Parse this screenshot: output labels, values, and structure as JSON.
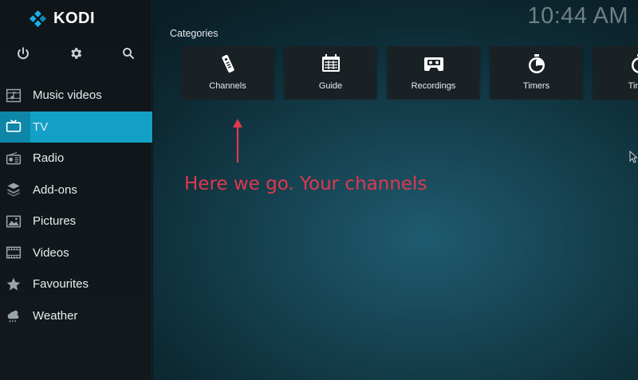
{
  "app": {
    "name": "KODI"
  },
  "clock": "10:44 AM",
  "top_icons": [
    "power-icon",
    "gear-icon",
    "search-icon"
  ],
  "menu": [
    {
      "label": "Music videos",
      "icon": "music-video-icon",
      "active": false
    },
    {
      "label": "TV",
      "icon": "tv-icon",
      "active": true
    },
    {
      "label": "Radio",
      "icon": "radio-icon",
      "active": false
    },
    {
      "label": "Add-ons",
      "icon": "addons-icon",
      "active": false
    },
    {
      "label": "Pictures",
      "icon": "pictures-icon",
      "active": false
    },
    {
      "label": "Videos",
      "icon": "videos-icon",
      "active": false
    },
    {
      "label": "Favourites",
      "icon": "star-icon",
      "active": false
    },
    {
      "label": "Weather",
      "icon": "weather-icon",
      "active": false
    }
  ],
  "main": {
    "categories_label": "Categories",
    "tiles": [
      {
        "label": "Channels",
        "icon": "remote-icon"
      },
      {
        "label": "Guide",
        "icon": "guide-icon"
      },
      {
        "label": "Recordings",
        "icon": "cassette-icon"
      },
      {
        "label": "Timers",
        "icon": "timer-icon"
      },
      {
        "label": "Timer",
        "icon": "timer-icon"
      }
    ]
  },
  "annotation": {
    "text": "Here we go. Your channels",
    "color": "#e0384f"
  },
  "colors": {
    "accent": "#12a0c7",
    "accent_dark": "#0e86a7",
    "logo": "#17b2e7"
  }
}
